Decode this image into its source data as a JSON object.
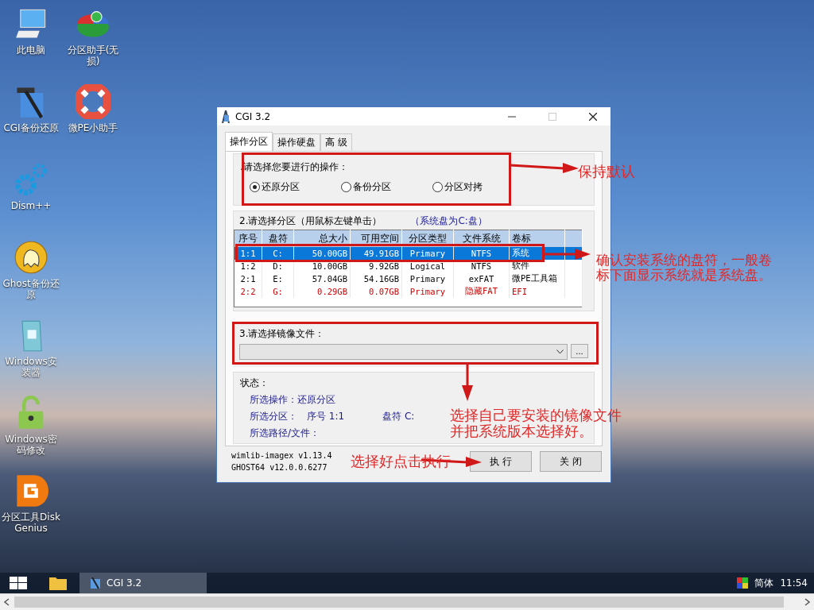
{
  "desktop_rows": [
    {
      "icons": [
        {
          "label": "此电脑",
          "kind": "computer"
        },
        {
          "label": "分区助手(无损)",
          "kind": "pie"
        }
      ]
    },
    {
      "icons": [
        {
          "label": "CGI备份还原",
          "kind": "tools"
        },
        {
          "label": "微PE小助手",
          "kind": "lifebuoy"
        }
      ]
    },
    {
      "icons": [
        {
          "label": "Dism++",
          "kind": "gears"
        }
      ]
    },
    {
      "icons": [
        {
          "label": "Ghost备份还原",
          "kind": "ghost"
        }
      ]
    },
    {
      "icons": [
        {
          "label": "Windows安装器",
          "kind": "installer"
        }
      ]
    },
    {
      "icons": [
        {
          "label": "Windows密码修改",
          "kind": "lock"
        }
      ]
    },
    {
      "icons": [
        {
          "label": "分区工具DiskGenius",
          "kind": "diskgenius"
        }
      ]
    }
  ],
  "window": {
    "title": "CGI 3.2",
    "tabs": [
      {
        "label": "操作分区",
        "selected": true
      },
      {
        "label": "操作硬盘",
        "selected": false
      },
      {
        "label": "高 级",
        "selected": false
      }
    ],
    "operation": {
      "label": ".请选择您要进行的操作：",
      "options": [
        {
          "label": "还原分区",
          "selected": true
        },
        {
          "label": "备份分区",
          "selected": false
        },
        {
          "label": "分区对拷",
          "selected": false
        }
      ]
    },
    "partitions": {
      "label": "2.请选择分区（用鼠标左键单击）",
      "note": "（系统盘为C:盘）",
      "columns": [
        "序号",
        "盘符",
        "总大小",
        "可用空间",
        "分区类型",
        "文件系统",
        "卷标"
      ],
      "rows": [
        {
          "cells": [
            "1:1",
            "C:",
            "50.00GB",
            "49.91GB",
            "Primary",
            "NTFS",
            "系统"
          ],
          "selected": true,
          "kind": "normal"
        },
        {
          "cells": [
            "1:2",
            "D:",
            "10.00GB",
            "9.92GB",
            "Logical",
            "NTFS",
            "软件"
          ],
          "selected": false,
          "kind": "normal"
        },
        {
          "cells": [
            "2:1",
            "E:",
            "57.04GB",
            "54.16GB",
            "Primary",
            "exFAT",
            "微PE工具箱"
          ],
          "selected": false,
          "kind": "normal"
        },
        {
          "cells": [
            "2:2",
            "G:",
            "0.29GB",
            "0.07GB",
            "Primary",
            "隐藏FAT",
            "EFI"
          ],
          "selected": false,
          "kind": "hidden"
        }
      ]
    },
    "image": {
      "label": "3.请选择镜像文件：",
      "browse_button": "..."
    },
    "status": {
      "label": "状态：",
      "operation": "所选操作：还原分区",
      "partition_label": "所选分区：",
      "partition_index": "序号 1:1",
      "partition_drive": "盘符 C:",
      "path": "所选路径/文件："
    },
    "versions": [
      "wimlib-imagex v1.13.4",
      "GHOST64 v12.0.0.6277"
    ],
    "buttons": [
      "执 行",
      "关 闭"
    ]
  },
  "annotations": [
    "保持默认",
    "确认安装系统的盘符，一般卷标下面显示系统就是系统盘。",
    "选择自己要安装的镜像文件并把系统版本选择好。",
    "选择好点击执行"
  ],
  "taskbar": {
    "task": "CGI 3.2",
    "language": "简体",
    "clock": "11:54"
  }
}
